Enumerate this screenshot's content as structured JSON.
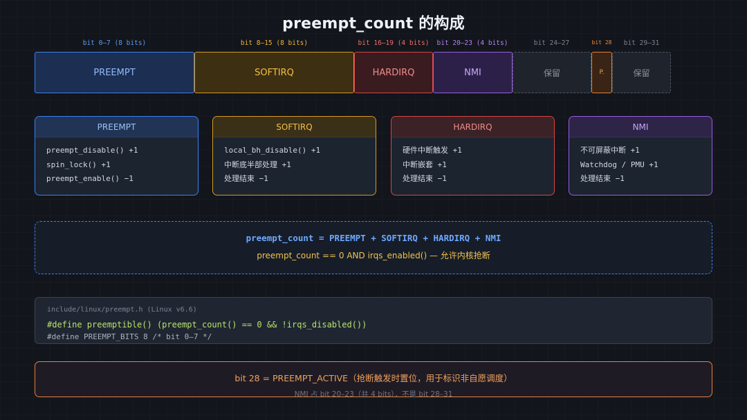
{
  "title": "preempt_count 的构成",
  "colors": {
    "preempt": "#3b82f6",
    "softirq": "#f59e0b",
    "hardirq": "#ef4444",
    "nmi": "#a855f7",
    "reserved": "#4b5563",
    "active": "#f97316"
  },
  "bit_labels": [
    {
      "text": "bit 0–7 (8 bits)"
    },
    {
      "text": "bit 8–15 (8 bits)"
    },
    {
      "text": "bit 16–19 (4 bits)"
    },
    {
      "text": "bit 20–23 (4 bits)"
    },
    {
      "text": "bit 24–27"
    },
    {
      "text": "bit 28"
    },
    {
      "text": "bit 29–31"
    }
  ],
  "segments": [
    {
      "label": "PREEMPT"
    },
    {
      "label": "SOFTIRQ"
    },
    {
      "label": "HARDIRQ"
    },
    {
      "label": "NMI"
    },
    {
      "label": "保留"
    },
    {
      "label": "P."
    },
    {
      "label": "保留"
    }
  ],
  "cards": [
    {
      "title": "PREEMPT",
      "lines": [
        "preempt_disable() +1",
        "spin_lock() +1",
        "preempt_enable() −1"
      ]
    },
    {
      "title": "SOFTIRQ",
      "lines": [
        "local_bh_disable() +1",
        "中断底半部处理 +1",
        "处理结束 −1"
      ]
    },
    {
      "title": "HARDIRQ",
      "lines": [
        "硬件中断触发 +1",
        "中断嵌套 +1",
        "处理结束 −1"
      ]
    },
    {
      "title": "NMI",
      "lines": [
        "不可屏蔽中断 +1",
        "Watchdog / PMU +1",
        "处理结束 −1"
      ]
    }
  ],
  "formula": {
    "line1": "preempt_count = PREEMPT + SOFTIRQ + HARDIRQ + NMI",
    "line2": "preempt_count == 0 AND irqs_enabled() — 允许内核抢断"
  },
  "code": {
    "file": "include/linux/preempt.h (Linux v6.6)",
    "line1": "#define preemptible() (preempt_count() == 0 && !irqs_disabled())",
    "line2": "#define PREEMPT_BITS 8 /* bit 0–7 */"
  },
  "note": {
    "line1": "bit 28 = PREEMPT_ACTIVE（抢断触发时置位，用于标识非自愿调度）",
    "line2": "NMI 占 bit 20–23（共 4 bits），不是 bit 28–31"
  }
}
